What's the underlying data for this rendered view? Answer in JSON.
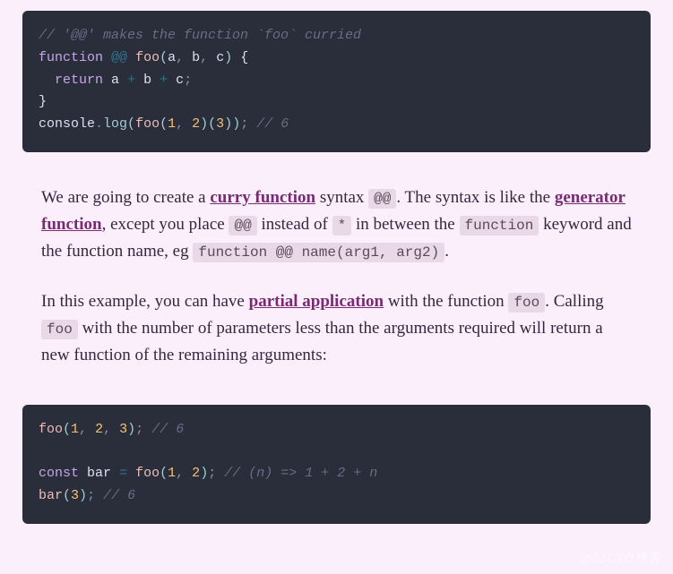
{
  "code1": {
    "l1_comment": "// '@@' makes the function `foo` curried",
    "l2_kw_function": "function",
    "l2_op": "@@",
    "l2_fn": "foo",
    "l2_p_a": "a",
    "l2_p_b": "b",
    "l2_p_c": "c",
    "l3_return": "return",
    "l3_a": "a",
    "l3_b": "b",
    "l3_c": "c",
    "l5_console": "console",
    "l5_log": "log",
    "l5_foo": "foo",
    "l5_n1": "1",
    "l5_n2": "2",
    "l5_n3": "3",
    "l5_comment": "// 6"
  },
  "para1": {
    "t1": "We are going to create a ",
    "link_curry": "curry function",
    "t2": " syntax ",
    "code_atat": "@@",
    "t3": ". The syntax is like the ",
    "link_gen": "generator function",
    "t4": ", except you place ",
    "code_atat2": "@@",
    "t5": " instead of ",
    "code_star": "*",
    "t6": " in between the ",
    "code_fn": "function",
    "t7": " keyword and the function name, eg ",
    "code_sig": "function @@ name(arg1, arg2)",
    "t8": "."
  },
  "para2": {
    "t1": "In this example, you can have ",
    "link_partial": "partial application",
    "t2": " with the function ",
    "code_foo": "foo",
    "t3": ". Calling ",
    "code_foo2": "foo",
    "t4": " with the number of parameters less than the arguments required will return a new function of the remaining arguments:"
  },
  "code2": {
    "l1_foo": "foo",
    "l1_n1": "1",
    "l1_n2": "2",
    "l1_n3": "3",
    "l1_comment": "// 6",
    "l3_const": "const",
    "l3_bar": "bar",
    "l3_eq": "=",
    "l3_foo": "foo",
    "l3_n1": "1",
    "l3_n2": "2",
    "l3_comment": "// (n) => 1 + 2 + n",
    "l4_bar": "bar",
    "l4_n3": "3",
    "l4_comment": "// 6"
  },
  "watermark": "@51CTO博客"
}
